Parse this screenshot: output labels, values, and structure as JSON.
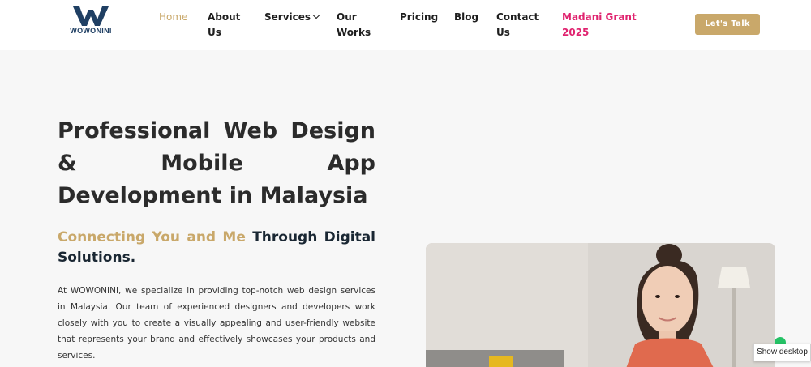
{
  "brand": {
    "name": "WOWONINI",
    "logo_icon": "w-logo-icon",
    "color": "#1f3f63"
  },
  "nav": {
    "home": "Home",
    "about_1": "About",
    "about_2": "Us",
    "services": "Services",
    "works_1": "Our",
    "works_2": "Works",
    "pricing": "Pricing",
    "blog": "Blog",
    "contact_1": "Contact",
    "contact_2": "Us",
    "grant_1": "Madani Grant",
    "grant_2": "2025",
    "active_color": "#c9a86a",
    "promo_color": "#e0236f"
  },
  "cta": {
    "label": "Let's Talk",
    "color": "#c9a86a"
  },
  "hero": {
    "title": "Professional Web Design & Mobile App Development in Malaysia",
    "subtitle_highlight": "Connecting You and Me",
    "subtitle_rest": " Through Digital Solutions.",
    "description": "At WOWONINI, we specialize in providing top-notch web design services in Malaysia. Our team of experienced designers and developers work closely with you to create a visually appealing and user-friendly website that represents your brand and effectively showcases your products and services.",
    "image_icon": "woman-smiling-photo"
  },
  "floating": {
    "whatsapp_icon": "whatsapp-icon",
    "show_desktop": "Show desktop"
  }
}
